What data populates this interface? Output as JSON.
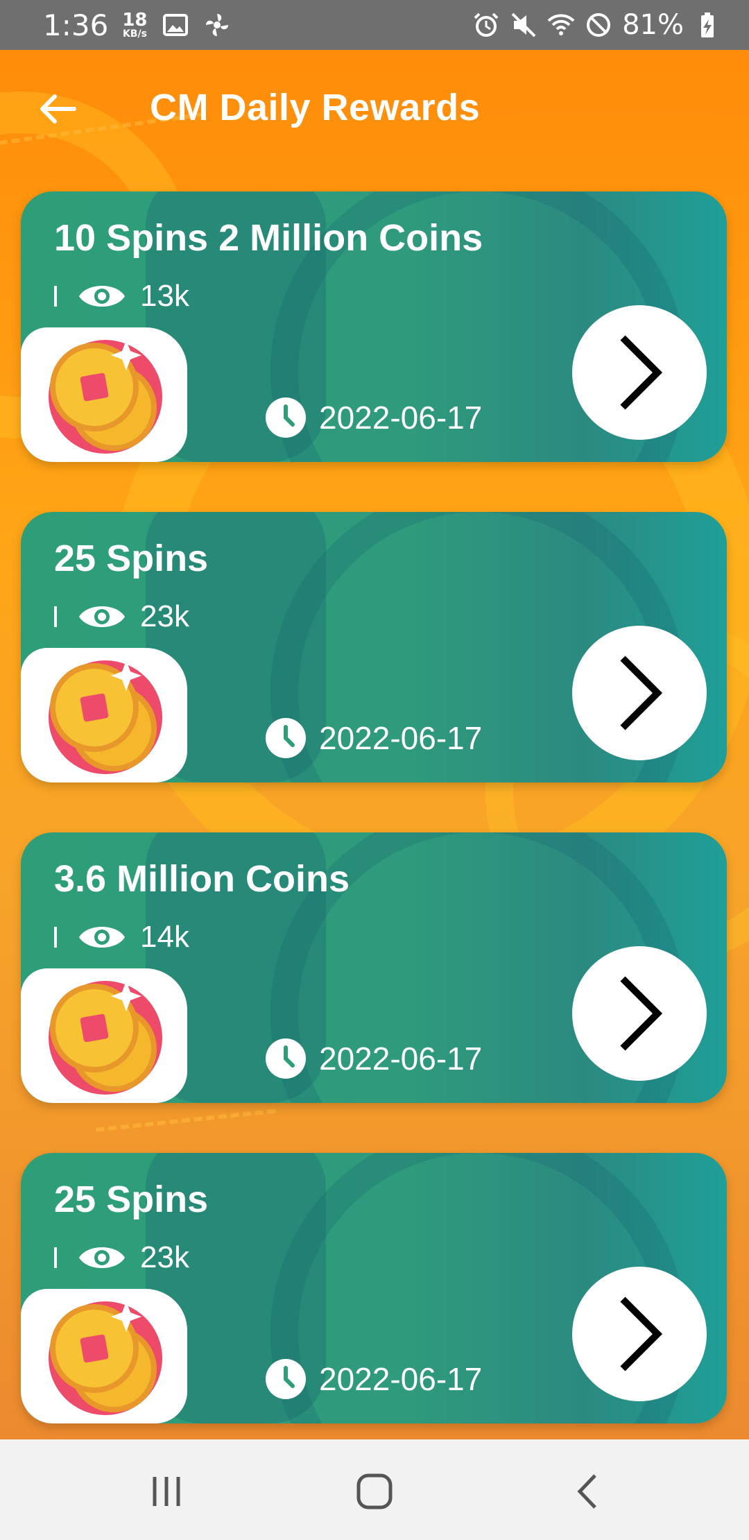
{
  "status_bar": {
    "time": "1:36",
    "net_speed_value": "18",
    "net_speed_unit": "KB/s",
    "battery_percent": "81%",
    "icons": [
      "image-icon",
      "settings-fan-icon",
      "alarm-icon",
      "mute-icon",
      "wifi-icon",
      "do-not-disturb-icon",
      "battery-charging-icon"
    ]
  },
  "header": {
    "title": "CM Daily Rewards",
    "back_icon": "back-arrow-icon"
  },
  "cards": [
    {
      "title": "10 Spins 2 Million Coins",
      "views": "13k",
      "date": "2022-06-17"
    },
    {
      "title": "25 Spins",
      "views": "23k",
      "date": "2022-06-17"
    },
    {
      "title": "3.6 Million Coins",
      "views": "14k",
      "date": "2022-06-17"
    },
    {
      "title": "25 Spins",
      "views": "23k",
      "date": "2022-06-17"
    }
  ],
  "card_icons": {
    "views": "eye-icon",
    "date": "clock-icon",
    "thumbnail": "coin-icon",
    "action": "chevron-right-icon"
  },
  "nav_bar": {
    "buttons": [
      "recent-apps-icon",
      "home-icon",
      "back-icon"
    ]
  },
  "colors": {
    "status_bar": "#6f6f6f",
    "app_background": "#ff8c0a",
    "card_green": "#2e9e78",
    "nav_bar": "#f2f2f2"
  }
}
